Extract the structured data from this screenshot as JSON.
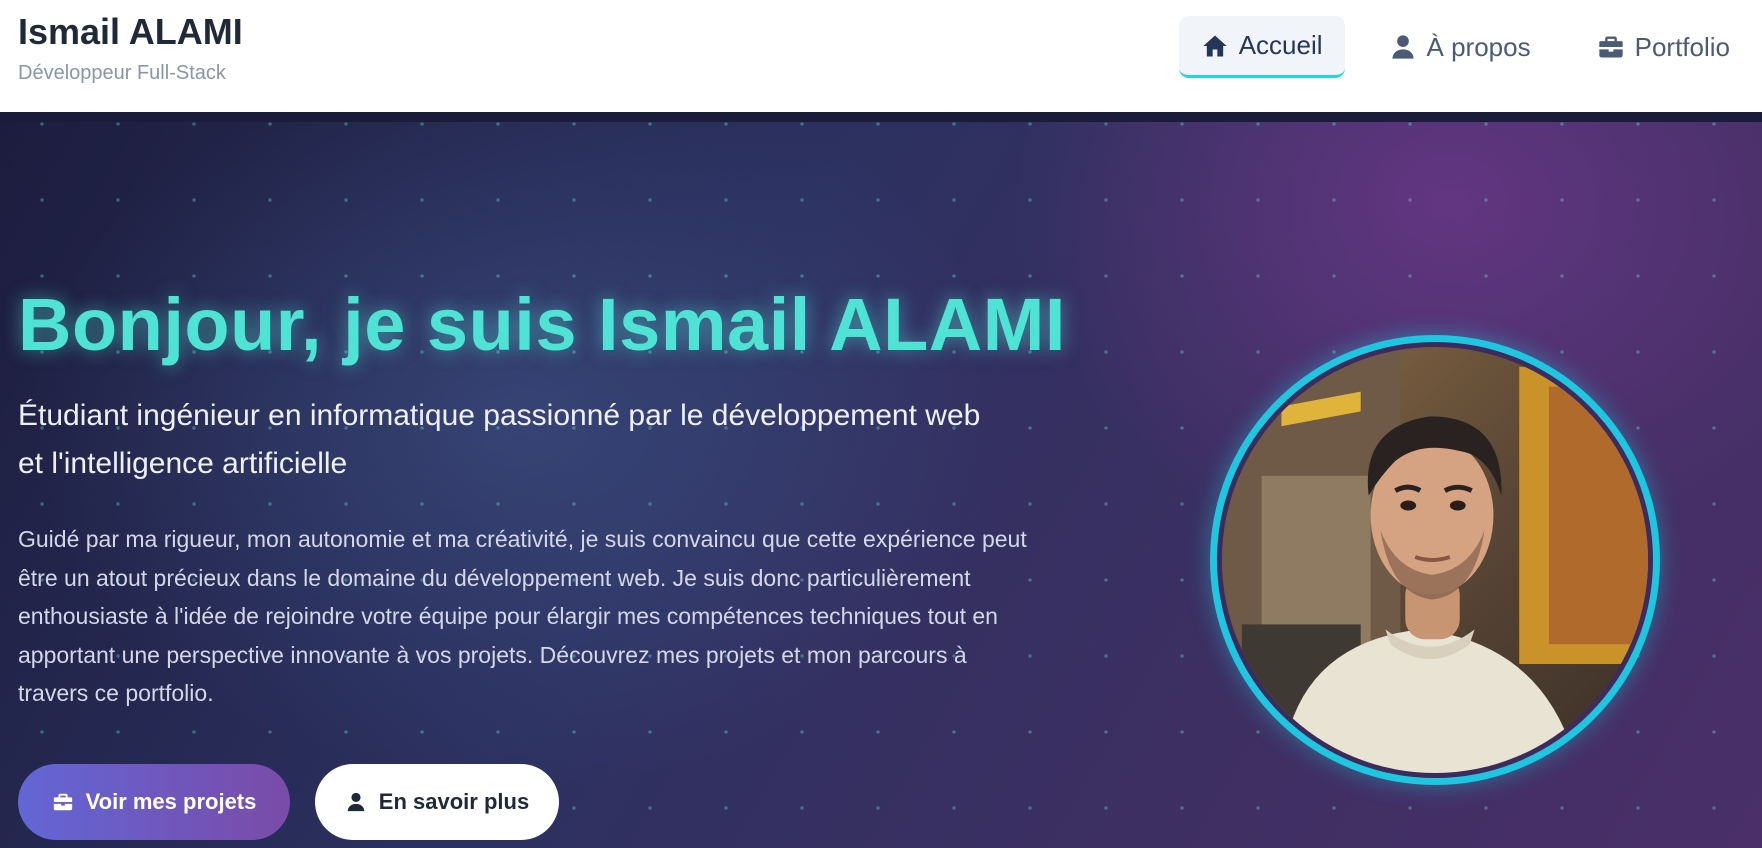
{
  "header": {
    "name": "Ismail ALAMI",
    "tagline": "Développeur Full-Stack",
    "nav": [
      {
        "label": "Accueil",
        "icon": "home-icon",
        "active": true
      },
      {
        "label": "À propos",
        "icon": "user-icon",
        "active": false
      },
      {
        "label": "Portfolio",
        "icon": "briefcase-icon",
        "active": false
      }
    ]
  },
  "hero": {
    "title": "Bonjour, je suis Ismail ALAMI",
    "subtitle": "Étudiant ingénieur en informatique passionné par le développement web et l'intelligence artificielle",
    "description": "Guidé par ma rigueur, mon autonomie et ma créativité, je suis convaincu que cette expérience peut être un atout précieux dans le domaine du développement web. Je suis donc particulièrement enthousiaste à l'idée de rejoindre votre équipe pour élargir mes compétences techniques tout en apportant une perspective innovante à vos projets. Découvrez mes projets et mon parcours à travers ce portfolio.",
    "primary_button": {
      "label": "Voir mes projets",
      "icon": "briefcase-icon"
    },
    "secondary_button": {
      "label": "En savoir plus",
      "icon": "user-icon"
    },
    "avatar": "profile-photo"
  },
  "colors": {
    "accent": "#4fe3d6",
    "ring": "#1fc6e0",
    "primary_button_start": "#6366d6",
    "primary_button_end": "#7a4ba8"
  }
}
